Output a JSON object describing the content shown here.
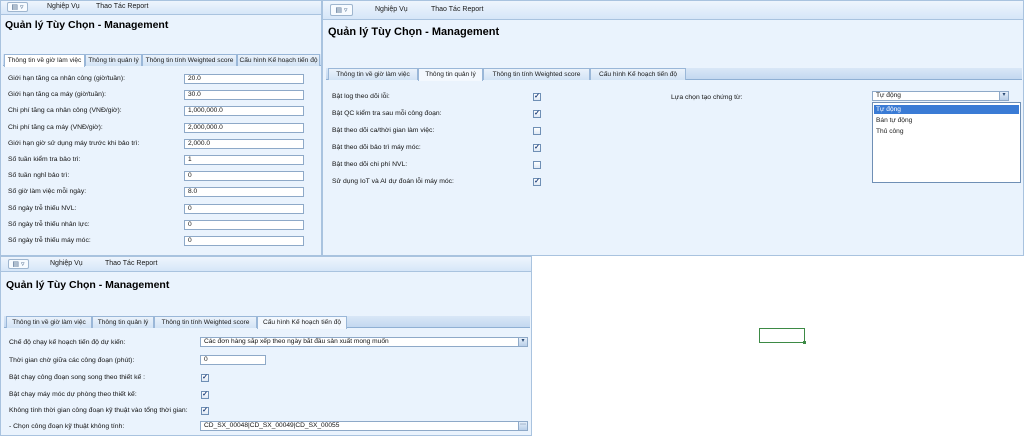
{
  "menu": {
    "nghiep_vu": "Nghiệp Vụ",
    "thao_tac_report": "Thao Tác Report"
  },
  "title": "Quản lý Tùy Chọn - Management",
  "tabs": [
    "Thông tin về giờ làm việc",
    "Thông tin quản lý",
    "Thông tin tính Weighted score",
    "Cấu hình Kế hoạch tiến độ"
  ],
  "panel1": {
    "fields": [
      {
        "label": "Giới hạn tăng ca nhân công (giờ/tuần):",
        "value": "20.0"
      },
      {
        "label": "Giới hạn tăng ca máy (giờ/tuần):",
        "value": "30.0"
      },
      {
        "label": "Chi phí tăng ca nhân công (VNĐ/giờ):",
        "value": "1,000,000.0"
      },
      {
        "label": "Chi phí tăng ca máy (VNĐ/giờ):",
        "value": "2,000,000.0"
      },
      {
        "label": "Giới hạn giờ sử dụng máy trước khi bảo trì:",
        "value": "2,000.0"
      },
      {
        "label": "Số tuần kiểm tra bảo trì:",
        "value": "1"
      },
      {
        "label": "Số tuần nghỉ bảo trì:",
        "value": "0"
      },
      {
        "label": "Số giờ làm việc mỗi ngày:",
        "value": "8.0"
      },
      {
        "label": "Số ngày trễ thiếu NVL:",
        "value": "0"
      },
      {
        "label": "Số ngày trễ thiếu nhân lực:",
        "value": "0"
      },
      {
        "label": "Số ngày trễ thiếu máy móc:",
        "value": "0"
      }
    ]
  },
  "panel2": {
    "checks": [
      {
        "label": "Bật log theo dõi lỗi:",
        "checked": true
      },
      {
        "label": "Bật QC kiểm tra sau mỗi công đoạn:",
        "checked": true
      },
      {
        "label": "Bật theo dõi ca/thời gian làm việc:",
        "checked": false
      },
      {
        "label": "Bật theo dõi bảo trì máy móc:",
        "checked": true
      },
      {
        "label": "Bật theo dõi chi phí NVL:",
        "checked": false
      },
      {
        "label": "Sử dụng IoT và AI dự đoán lỗi máy móc:",
        "checked": true
      }
    ],
    "voucher_label": "Lựa chọn tạo chứng từ:",
    "voucher_value": "Tự động",
    "voucher_options": [
      "Tự động",
      "Bán tự động",
      "Thủ công"
    ]
  },
  "panel3": {
    "schedule_mode_label": "Chế độ chạy kế hoạch tiến độ dự kiến:",
    "schedule_mode_value": "Các đơn hàng sắp xếp theo ngày bắt đầu sản xuất mong muốn",
    "wait_time_label": "Thời gian chờ giữa các công đoạn (phút):",
    "wait_time_value": "0",
    "checks": [
      {
        "label": "Bật chạy công đoạn song song theo thiết kế :",
        "checked": true
      },
      {
        "label": "Bật chạy máy móc dự phòng theo thiết kế:",
        "checked": true
      },
      {
        "label": "Không tính thời gian công đoạn kỹ thuật vào tổng thời gian:",
        "checked": true
      }
    ],
    "tech_steps_label": "- Chọn công đoạn kỹ thuật không tính:",
    "tech_steps_value": "CD_SX_00048|CD_SX_00049|CD_SX_00055"
  },
  "check_mark": "✓"
}
